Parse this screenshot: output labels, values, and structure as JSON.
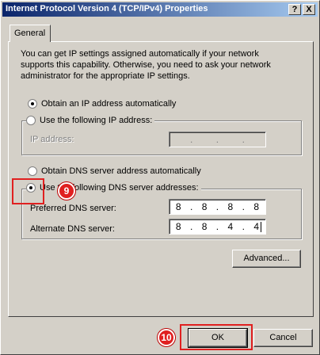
{
  "window": {
    "title": "Internet Protocol Version 4 (TCP/IPv4) Properties",
    "help_glyph": "?",
    "close_glyph": "X"
  },
  "tabs": [
    {
      "label": "General"
    }
  ],
  "description": "You can get IP settings assigned automatically if your network supports this capability. Otherwise, you need to ask your network administrator for the appropriate IP settings.",
  "ip": {
    "auto_label": "Obtain an IP address automatically",
    "auto_selected": true,
    "manual_label": "Use the following IP address:",
    "address_label": "IP address:",
    "address_octets": [
      "",
      "",
      "",
      ""
    ]
  },
  "dns": {
    "auto_label": "Obtain DNS server address automatically",
    "manual_label": "Use the following DNS server addresses:",
    "manual_selected": true,
    "preferred_label": "Preferred DNS server:",
    "preferred_octets": [
      "8",
      "8",
      "8",
      "8"
    ],
    "alternate_label": "Alternate DNS server:",
    "alternate_octets": [
      "8",
      "8",
      "4",
      "4"
    ]
  },
  "buttons": {
    "advanced": "Advanced...",
    "ok": "OK",
    "cancel": "Cancel"
  },
  "callouts": {
    "step9": "9",
    "step10": "10",
    "color": "#e02020"
  }
}
